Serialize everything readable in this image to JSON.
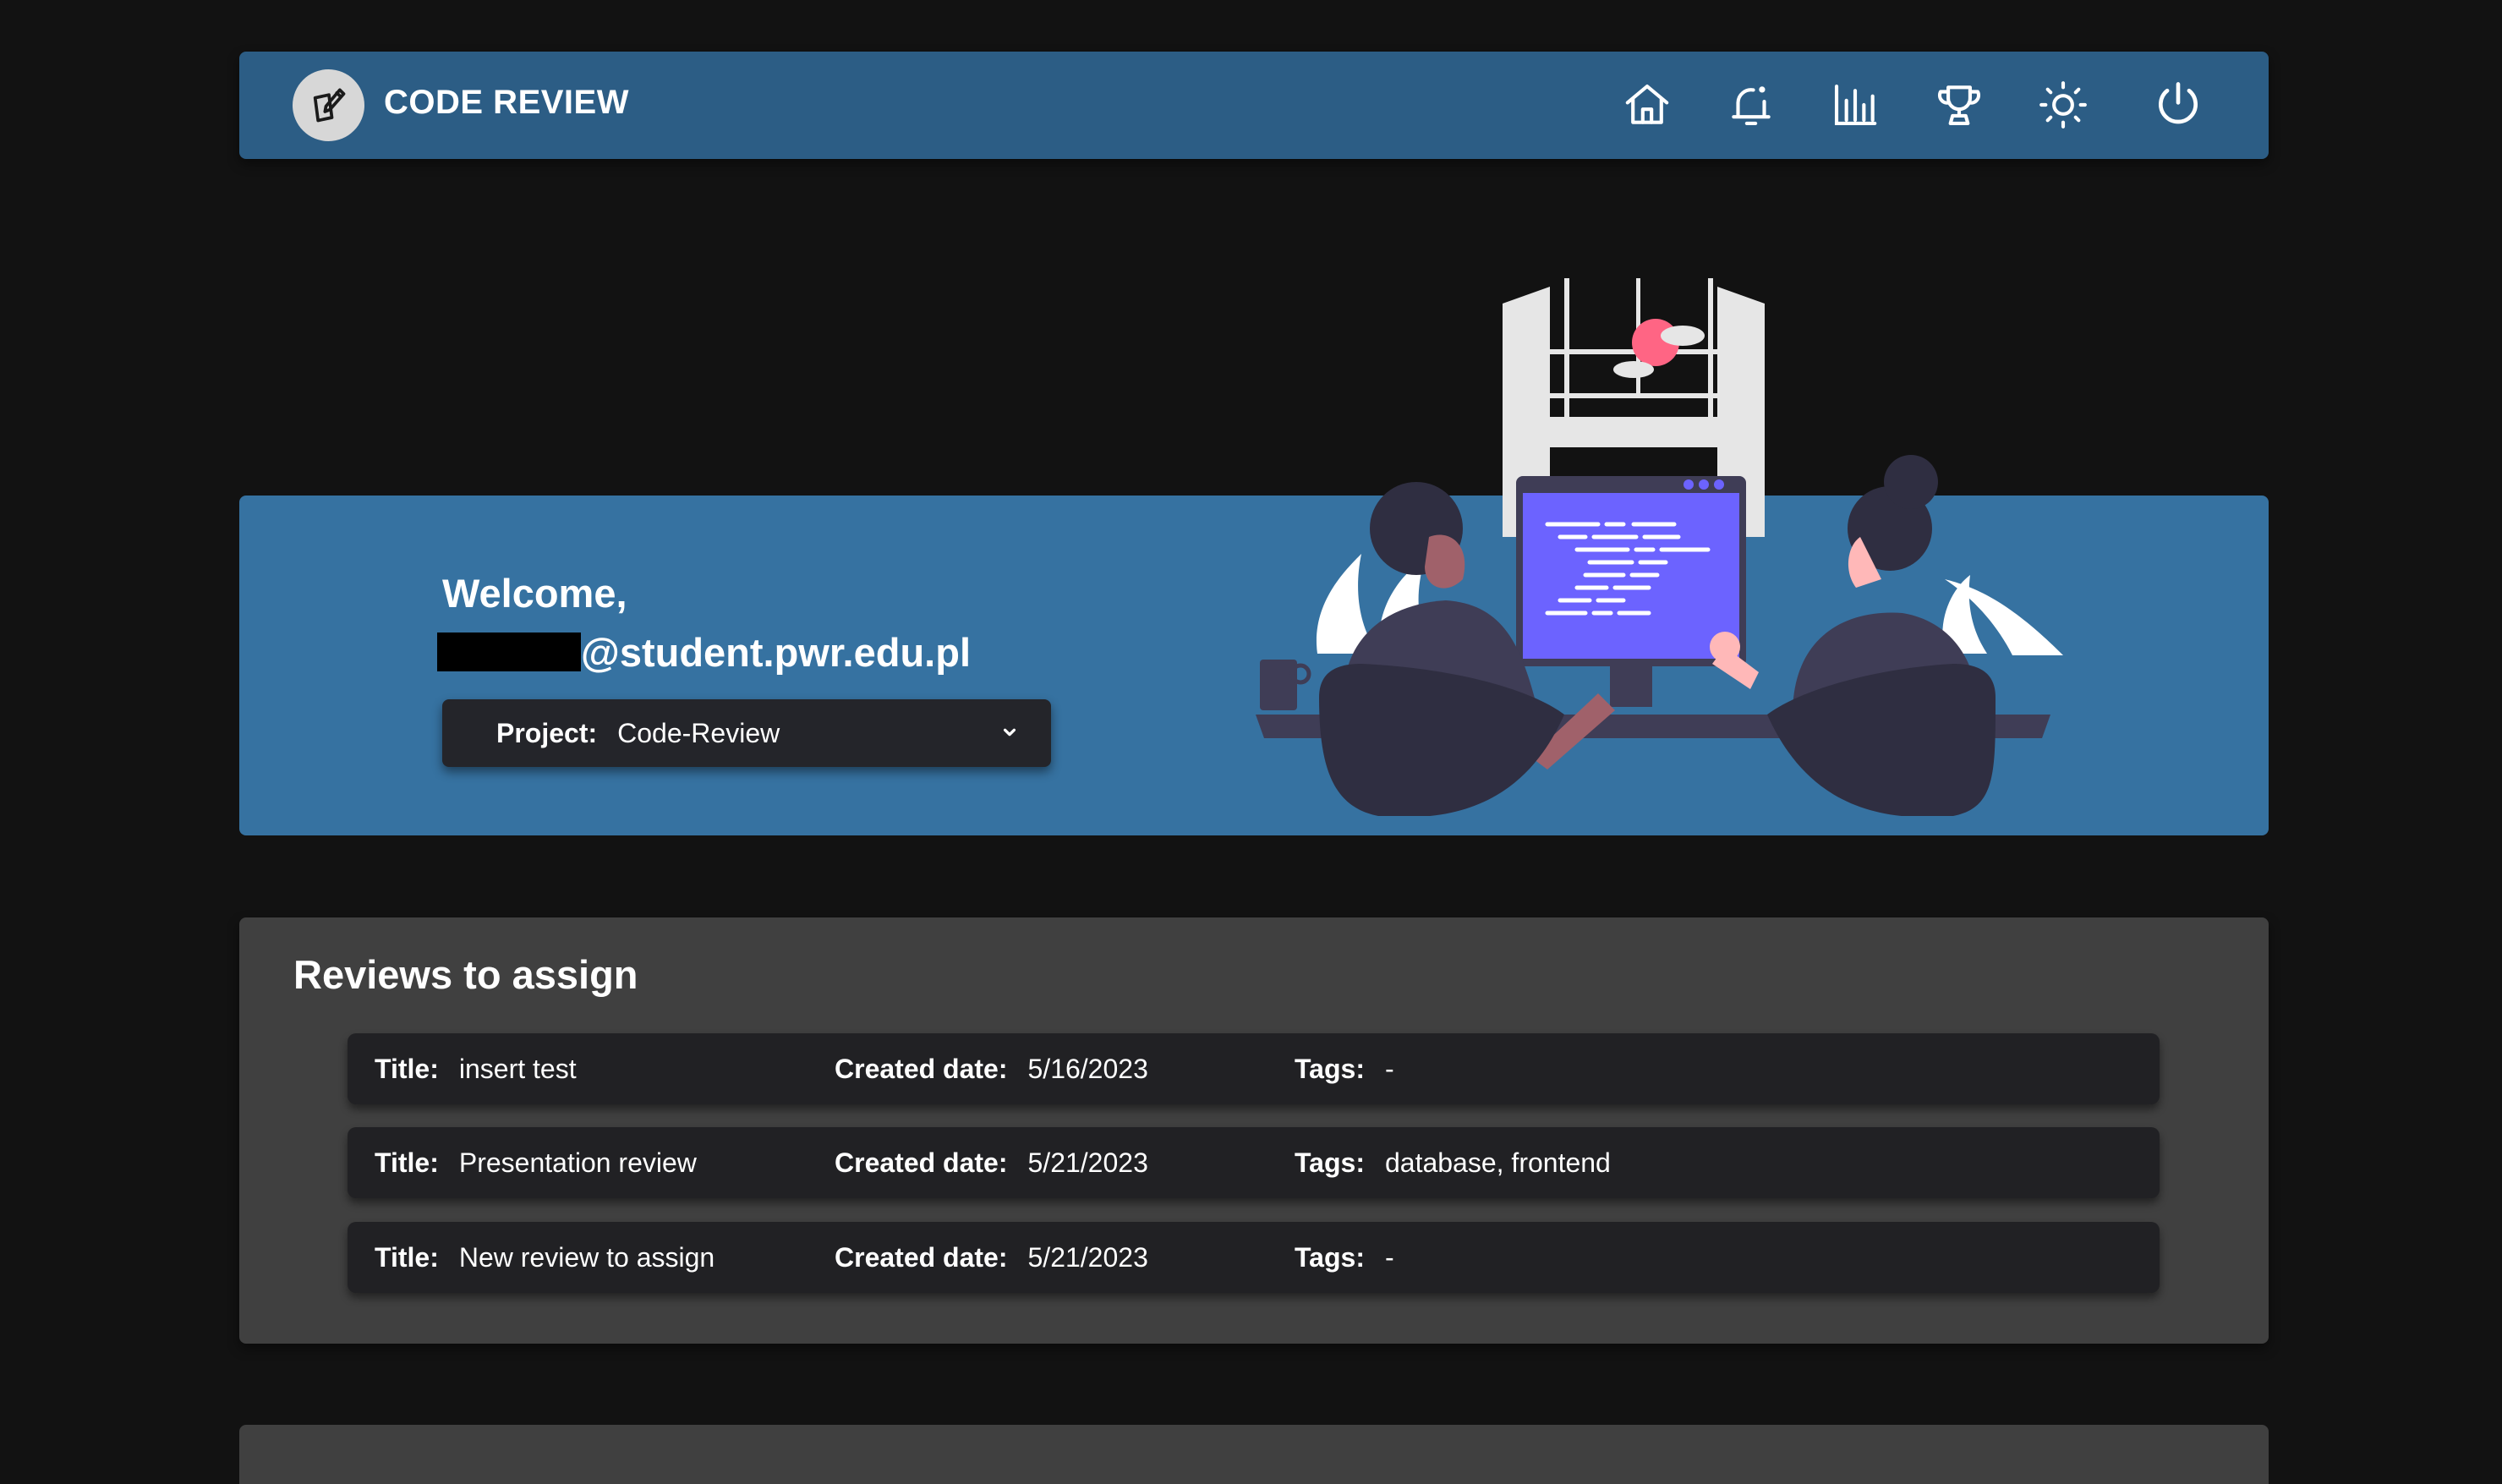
{
  "header": {
    "app_title": "CODE REVIEW",
    "logo_icon": "pencil-square-icon",
    "nav": [
      {
        "name": "home",
        "icon": "home-icon"
      },
      {
        "name": "notifications",
        "icon": "bell-icon"
      },
      {
        "name": "statistics",
        "icon": "bar-chart-icon"
      },
      {
        "name": "achievements",
        "icon": "trophy-icon"
      },
      {
        "name": "theme",
        "icon": "sun-icon"
      },
      {
        "name": "logout",
        "icon": "power-icon"
      }
    ]
  },
  "welcome": {
    "greeting": "Welcome,",
    "email_suffix": "@student.pwr.edu.pl",
    "project_label": "Project:",
    "project_value": "Code-Review"
  },
  "reviews": {
    "title": "Reviews to assign",
    "labels": {
      "title": "Title:",
      "created": "Created date:",
      "tags": "Tags:"
    },
    "items": [
      {
        "title": "insert test",
        "created": "5/16/2023",
        "tags": "-"
      },
      {
        "title": "Presentation review",
        "created": "5/21/2023",
        "tags": "database, frontend"
      },
      {
        "title": "New review to assign",
        "created": "5/21/2023",
        "tags": "-"
      }
    ]
  },
  "colors": {
    "page_bg": "#121212",
    "header_bg": "#2c5d85",
    "banner_bg": "#3672a1",
    "card_bg": "#404040",
    "row_bg": "#212124",
    "screen_accent": "#6c63ff"
  }
}
